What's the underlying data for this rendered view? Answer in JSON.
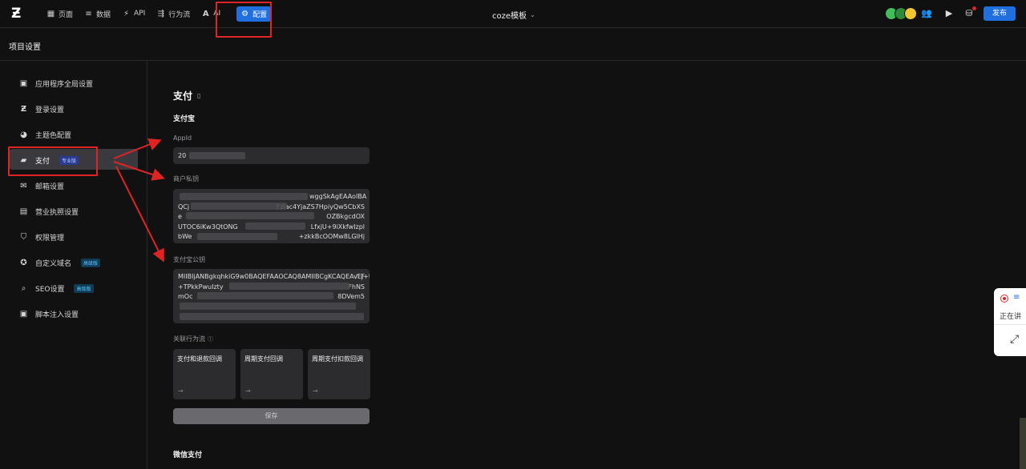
{
  "topbar": {
    "nav": [
      {
        "icon": "page-icon",
        "label": "页面"
      },
      {
        "icon": "database-icon",
        "label": "数据"
      },
      {
        "icon": "api-icon",
        "label": "API"
      },
      {
        "icon": "workflow-icon",
        "label": "行为流"
      },
      {
        "icon": "ai-icon",
        "label": "AI"
      }
    ],
    "config_label": "配置",
    "project_title": "coze模板",
    "publish_label": "发布"
  },
  "settings_title": "项目设置",
  "sidebar": {
    "items": [
      {
        "label": "应用程序全局设置",
        "icon": "terminal-icon"
      },
      {
        "label": "登录设置",
        "icon": "z-logo-icon"
      },
      {
        "label": "主题色配置",
        "icon": "palette-icon"
      },
      {
        "label": "支付",
        "icon": "wallet-icon",
        "badge": "专业版"
      },
      {
        "label": "邮箱设置",
        "icon": "mail-icon"
      },
      {
        "label": "营业执照设置",
        "icon": "license-icon"
      },
      {
        "label": "权限管理",
        "icon": "shield-icon"
      },
      {
        "label": "自定义域名",
        "icon": "domain-icon",
        "badge": "高级版"
      },
      {
        "label": "SEO设置",
        "icon": "search-icon",
        "badge": "高级版"
      },
      {
        "label": "脚本注入设置",
        "icon": "script-icon"
      }
    ],
    "active_index": 3
  },
  "main": {
    "title": "支付",
    "alipay": {
      "section": "支付宝",
      "appid_label": "AppId",
      "appid_value": "20",
      "private_key_label": "商户私钥",
      "private_key_lines": [
        "wggSkAgEAAoIBA",
        "QCj",
        "e",
        "UTOC6iKw3QtONG",
        "bWe"
      ],
      "private_key_tail": [
        "...",
        "Fzlac4YjaZS7HpiyQw5CbXS",
        "OZBkgcdOX",
        "LfxjU+9iXkfwIzpl",
        "+zkkBcOOMw8LGlHj"
      ],
      "public_key_label": "支付宝公钥",
      "public_key_lines": [
        "MIIBIjANBgkqhkiG9w0BAQEFAAOCAQ8AMIIBCgKCAQEAvEj+U",
        "+TPkkPwuIzty",
        "mOc",
        "",
        ""
      ],
      "public_key_tail": [
        "",
        "/LF",
        "FhNS",
        "8DVem5",
        ""
      ]
    },
    "flow_label": "关联行为流",
    "flows": [
      "支付和退款回调",
      "周期支付回调",
      "周期支付扣款回调"
    ],
    "save_label": "保存",
    "wechat_section": "微信支付"
  },
  "float_panel": {
    "text": "正在讲"
  }
}
